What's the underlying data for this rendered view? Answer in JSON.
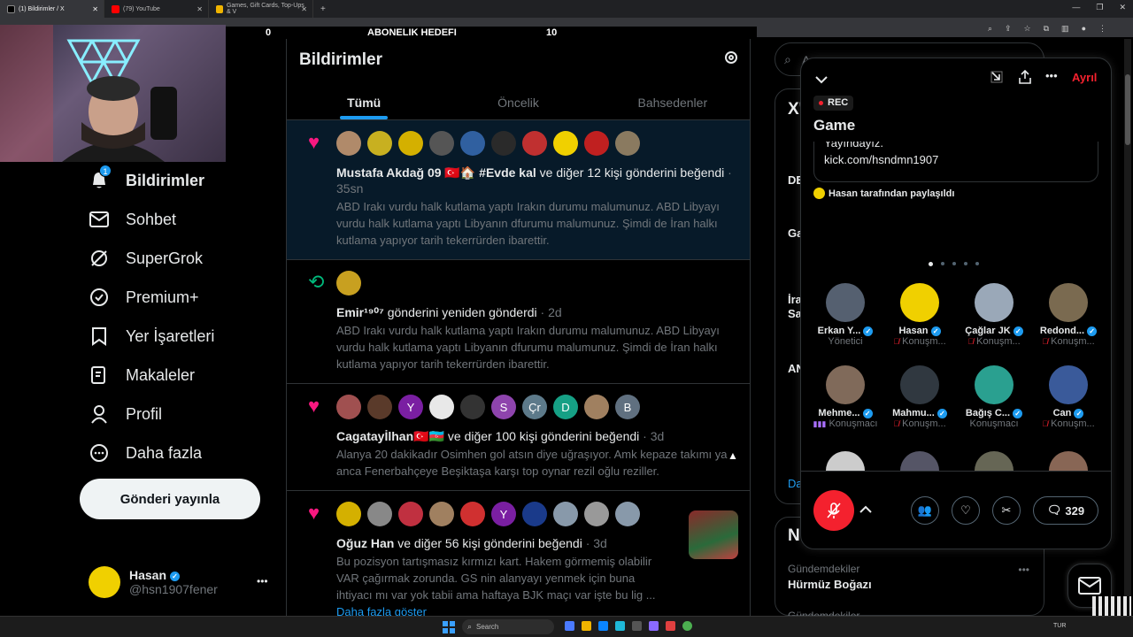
{
  "browser": {
    "tabs": [
      {
        "title": "(1) Bildirimler / X",
        "color": "#ffffff"
      },
      {
        "title": "(79) YouTube",
        "color": "#ff0000"
      },
      {
        "title": "Games, Gift Cards, Top-Ups & V",
        "color": "#f0b400"
      }
    ],
    "new_tab": "+"
  },
  "overlay": {
    "left": "0",
    "center": "ABONELIK HEDEFI",
    "right": "10"
  },
  "sidebar": {
    "items": [
      {
        "label": "Bildirimler",
        "icon": "bell-icon",
        "glyph": "🔔",
        "badge": "1",
        "bold": true
      },
      {
        "label": "Sohbet",
        "icon": "mail-icon",
        "glyph": "✉"
      },
      {
        "label": "SuperGrok",
        "icon": "grok-icon",
        "glyph": "⊘"
      },
      {
        "label": "Premium+",
        "icon": "premium-icon",
        "glyph": "✪"
      },
      {
        "label": "Yer İşaretleri",
        "icon": "bookmark-icon",
        "glyph": "⎕"
      },
      {
        "label": "Makaleler",
        "icon": "article-icon",
        "glyph": "✎"
      },
      {
        "label": "Profil",
        "icon": "profile-icon",
        "glyph": "👤"
      },
      {
        "label": "Daha fazla",
        "icon": "more-circle-icon",
        "glyph": "⋯"
      }
    ],
    "post_button": "Gönderi yayınla",
    "account": {
      "name": "Hasan",
      "handle": "@hsn1907fener",
      "menu": "•••"
    }
  },
  "main": {
    "title": "Bildirimler",
    "tabs": [
      "Tümü",
      "Öncelik",
      "Bahsedenler"
    ],
    "notifications": [
      {
        "lead": "♥",
        "lead_color": "#f91880",
        "avatars": [
          "#b08a6a",
          "#c8b020",
          "#d4b000",
          "#555",
          "#3060a0",
          "#2a2a2a",
          "#c03030",
          "#f0d000",
          "#c02020",
          "#8a7a60"
        ],
        "actor": "Mustafa Akdağ 09 🇹🇷🏠 #Evde kal",
        "action": "ve diğer 12 kişi gönderini beğendi",
        "time": "· 35sn",
        "text": "ABD Irakı vurdu halk kutlama yaptı Irakın durumu malumunuz. ABD Libyayı vurdu halk kutlama yaptı Libyanın dfurumu malumunuz. Şimdi de İran halkı kutlama yapıyor tarih tekerrürden ibarettir.",
        "highlight": true
      },
      {
        "lead": "⟲",
        "lead_color": "#00ba7c",
        "avatars": [
          "#c8a020"
        ],
        "actor": "Emir¹⁹⁰⁷",
        "action": "gönderini yeniden gönderdi",
        "time": "· 2d",
        "text": "ABD Irakı vurdu halk kutlama yaptı Irakın durumu malumunuz. ABD Libyayı vurdu halk kutlama yaptı Libyanın dfurumu malumunuz. Şimdi de İran halkı kutlama yapıyor tarih tekerrürden ibarettir."
      },
      {
        "lead": "♥",
        "lead_color": "#f91880",
        "avatars": [
          {
            "c": "#a05050",
            "t": ""
          },
          {
            "c": "#5a3a2a",
            "t": ""
          },
          {
            "c": "#7a1fa2",
            "t": "Y"
          },
          {
            "c": "#e8e8e8",
            "t": ""
          },
          {
            "c": "#333",
            "t": ""
          },
          {
            "c": "#8e44ad",
            "t": "S"
          },
          {
            "c": "#5d7a8a",
            "t": "Çr"
          },
          {
            "c": "#16a085",
            "t": "D"
          },
          {
            "c": "#a08060",
            "t": ""
          },
          {
            "c": "#607080",
            "t": "B"
          }
        ],
        "actor": "Cagatayİlhan🇹🇷🇦🇿",
        "action": "ve diğer 100 kişi gönderini beğendi",
        "time": "· 3d",
        "text": "Alanya 20 dakikadır Osimhen gol atsın diye uğraşıyor. Amk kepaze takımı ya anca Fenerbahçeye Beşiktaşa karşı top oynar rezil oğlu reziller."
      },
      {
        "lead": "♥",
        "lead_color": "#f91880",
        "avatars": [
          {
            "c": "#d4b000",
            "t": ""
          },
          {
            "c": "#888",
            "t": ""
          },
          {
            "c": "#c03040",
            "t": ""
          },
          {
            "c": "#a08060",
            "t": ""
          },
          {
            "c": "#d03030",
            "t": ""
          },
          {
            "c": "#7a1fa2",
            "t": "Y"
          },
          {
            "c": "#1a3a8a",
            "t": ""
          },
          {
            "c": "#8899aa",
            "t": ""
          },
          {
            "c": "#999",
            "t": ""
          },
          {
            "c": "#8899aa",
            "t": ""
          }
        ],
        "actor": "Oğuz Han",
        "action": "ve diğer 56 kişi gönderini beğendi",
        "time": "· 3d",
        "text": "Bu pozisyon tartışmasız kırmızı kart. Hakem görmemiş olabilir VAR çağırmak zorunda. GS nin alanyayı yenmek için buna ihtiyacı mı var yok tabii ama haftaya BJK maçı var işte bu lig ...",
        "more": "Daha fazla göster"
      }
    ]
  },
  "rightpane": {
    "search_placeholder": "A",
    "fragments": [
      "X'",
      "DE",
      "Ga",
      "İra",
      "Sa",
      "AN",
      "Da"
    ],
    "trends_header": "Ne",
    "trend": {
      "category": "Gündemdekiler",
      "topic": "Hürmüz Boğazı",
      "next": "Gündemdekiler"
    }
  },
  "space": {
    "leave": "Ayrıl",
    "rec": "REC",
    "title": "Game",
    "pinned_line1": "Yayındayız.",
    "pinned_line2": "kick.com/hsndmn1907",
    "shared_by": "Hasan tarafından paylaşıldı",
    "speakers": [
      {
        "name": "Erkan Y...",
        "role": "Yönetici",
        "color": "#556070",
        "muted": false
      },
      {
        "name": "Hasan",
        "role": "Konuşm...",
        "color": "#f0d000",
        "muted": true
      },
      {
        "name": "Çağlar JK",
        "role": "Konuşm...",
        "color": "#9aa8b8",
        "muted": true
      },
      {
        "name": "Redond...",
        "role": "Konuşm...",
        "color": "#7a6a50",
        "muted": true
      },
      {
        "name": "Mehme...",
        "role": "Konuşmacı",
        "color": "#806a5a",
        "muted": false,
        "talking": true
      },
      {
        "name": "Mahmu...",
        "role": "Konuşm...",
        "color": "#303840",
        "muted": true
      },
      {
        "name": "Bağış C...",
        "role": "Konuşmacı",
        "color": "#2aa090",
        "muted": false
      },
      {
        "name": "Can",
        "role": "Konuşm...",
        "color": "#3a5a9a",
        "muted": true
      }
    ],
    "reply_count": "329"
  },
  "taskbar": {
    "search": "Search",
    "lang": "TUR"
  }
}
